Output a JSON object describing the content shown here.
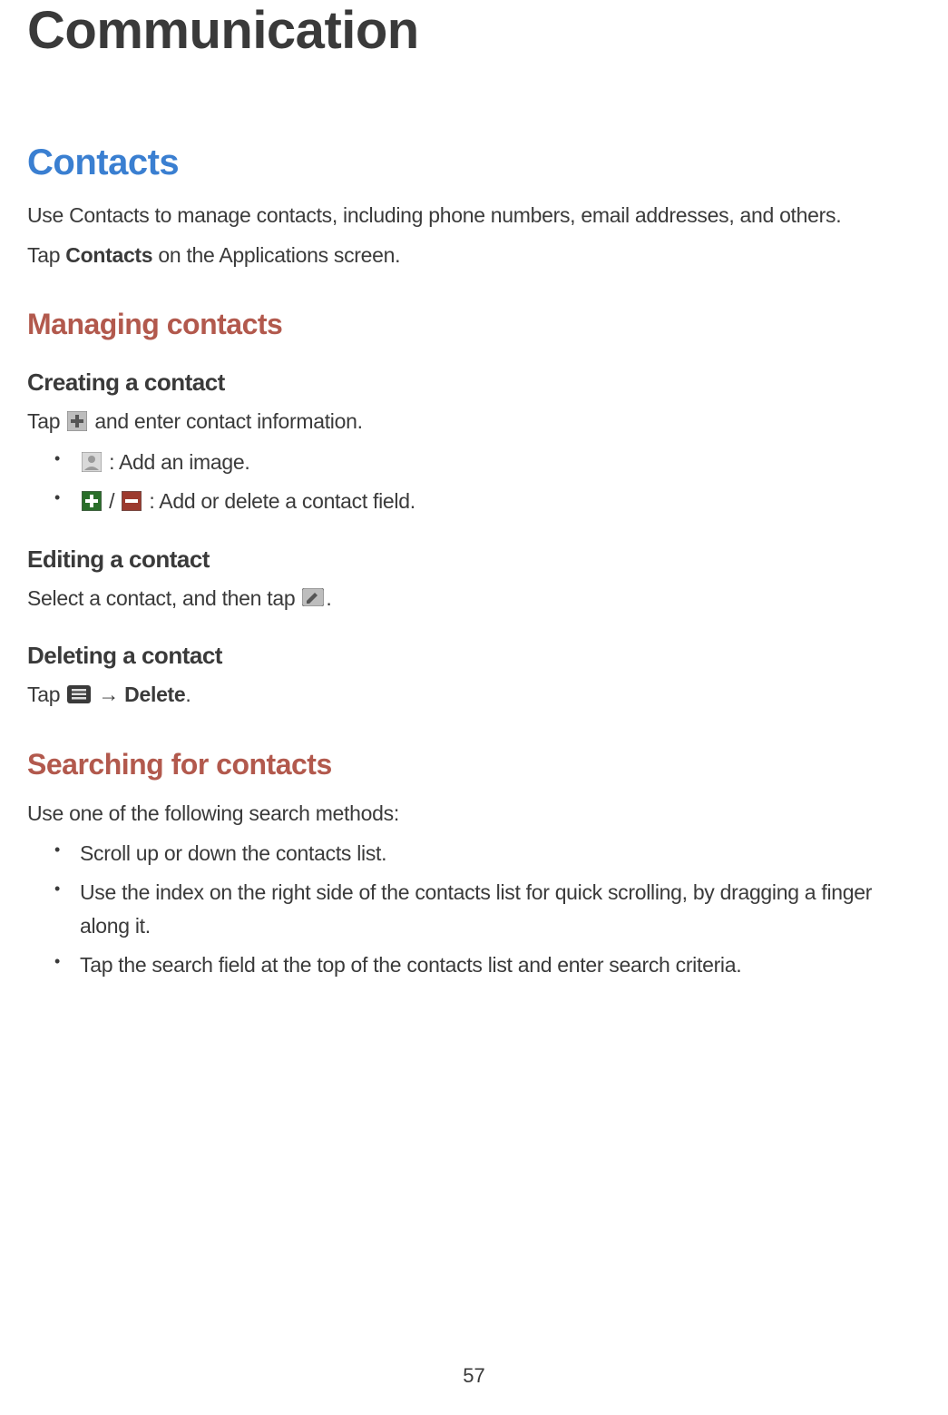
{
  "title": "Communication",
  "contacts": {
    "heading": "Contacts",
    "intro": "Use Contacts to manage contacts, including phone numbers, email addresses, and others.",
    "tap_prefix": "Tap ",
    "tap_bold": "Contacts",
    "tap_suffix": " on the Applications screen."
  },
  "managing": {
    "heading": "Managing contacts",
    "creating": {
      "heading": "Creating a contact",
      "line_prefix": "Tap ",
      "line_suffix": " and enter contact information.",
      "bullet1_suffix": " : Add an image.",
      "bullet2_mid": " / ",
      "bullet2_suffix": " : Add or delete a contact field."
    },
    "editing": {
      "heading": "Editing a contact",
      "line_prefix": "Select a contact, and then tap ",
      "line_suffix": "."
    },
    "deleting": {
      "heading": "Deleting a contact",
      "line_prefix": "Tap ",
      "arrow": " → ",
      "bold": "Delete",
      "suffix": "."
    }
  },
  "searching": {
    "heading": "Searching for contacts",
    "intro": "Use one of the following search methods:",
    "bullets": [
      "Scroll up or down the contacts list.",
      "Use the index on the right side of the contacts list for quick scrolling, by dragging a finger along it.",
      "Tap the search field at the top of the contacts list and enter search criteria."
    ]
  },
  "page_number": "57"
}
